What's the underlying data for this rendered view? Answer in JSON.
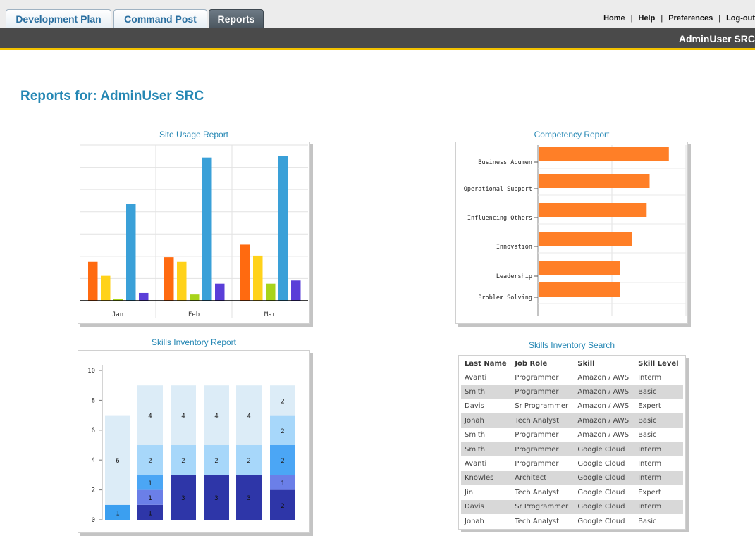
{
  "nav": {
    "tabs": [
      {
        "label": "Development Plan"
      },
      {
        "label": "Command Post"
      },
      {
        "label": "Reports"
      }
    ],
    "links": [
      "Home",
      "Help",
      "Preferences",
      "Log-out"
    ],
    "separator": "|",
    "user": "AdminUser SRC"
  },
  "page": {
    "title": "Reports for: AdminUser SRC"
  },
  "panels": {
    "site_usage": "Site Usage Report",
    "competency": "Competency Report",
    "skills_inventory": "Skills Inventory Report",
    "skills_search": "Skills Inventory Search"
  },
  "colors": {
    "accent": "#2587b4",
    "bar_orange": "#ff7f27",
    "site_series": [
      "#ff6a10",
      "#ffd21a",
      "#a8d41a",
      "#3aa0d8",
      "#5a3ed8"
    ],
    "stack_colors": [
      "#3b9ff0",
      "#2e36a8",
      "#6b7fe8",
      "#4ba6f5",
      "#a7d7fa",
      "#dcecf7"
    ]
  },
  "chart_data": [
    {
      "type": "bar",
      "title": "Site Usage Report",
      "categories": [
        "Jan",
        "Feb",
        "Mar"
      ],
      "ylim": [
        0,
        100
      ],
      "grid": true,
      "series": [
        {
          "values": [
            25,
            28,
            36
          ]
        },
        {
          "values": [
            16,
            25,
            29
          ]
        },
        {
          "values": [
            1,
            4,
            11
          ]
        },
        {
          "values": [
            62,
            92,
            93
          ]
        },
        {
          "values": [
            5,
            11,
            13
          ]
        }
      ]
    },
    {
      "type": "bar",
      "orientation": "horizontal",
      "title": "Competency Report",
      "categories": [
        "Business Acumen",
        "Operational Support",
        "Influencing Others",
        "Innovation",
        "Leadership",
        "Problem Solving"
      ],
      "values": [
        88,
        75,
        73,
        63,
        55,
        55
      ],
      "xlim": [
        0,
        100
      ],
      "grid": true
    },
    {
      "type": "bar",
      "stacked": true,
      "title": "Skills Inventory Report",
      "yticks": [
        "0",
        "2",
        "4",
        "6",
        "8",
        "10"
      ],
      "ylim": [
        0,
        10
      ],
      "columns": [
        [
          {
            "value": 1,
            "label": "1",
            "color": 0
          },
          {
            "value": 6,
            "label": "6",
            "color": 5
          }
        ],
        [
          {
            "value": 1,
            "label": "1",
            "color": 1
          },
          {
            "value": 1,
            "label": "1",
            "color": 2
          },
          {
            "value": 1,
            "label": "1",
            "color": 3
          },
          {
            "value": 2,
            "label": "2",
            "color": 4
          },
          {
            "value": 4,
            "label": "4",
            "color": 5
          }
        ],
        [
          {
            "value": 3,
            "label": "3",
            "color": 1
          },
          {
            "value": 2,
            "label": "2",
            "color": 4
          },
          {
            "value": 4,
            "label": "4",
            "color": 5
          }
        ],
        [
          {
            "value": 3,
            "label": "3",
            "color": 1
          },
          {
            "value": 2,
            "label": "2",
            "color": 4
          },
          {
            "value": 4,
            "label": "4",
            "color": 5
          }
        ],
        [
          {
            "value": 3,
            "label": "3",
            "color": 1
          },
          {
            "value": 2,
            "label": "2",
            "color": 4
          },
          {
            "value": 4,
            "label": "4",
            "color": 5
          }
        ],
        [
          {
            "value": 2,
            "label": "2",
            "color": 1
          },
          {
            "value": 1,
            "label": "1",
            "color": 2
          },
          {
            "value": 2,
            "label": "2",
            "color": 3
          },
          {
            "value": 2,
            "label": "2",
            "color": 4
          },
          {
            "value": 2,
            "label": "2",
            "color": 5
          }
        ]
      ]
    },
    {
      "type": "table",
      "title": "Skills Inventory Search",
      "columns": [
        "Last Name",
        "Job Role",
        "Skill",
        "Skill Level"
      ],
      "rows": [
        [
          "Avanti",
          "Programmer",
          "Amazon / AWS",
          "Interm"
        ],
        [
          "Smith",
          "Programmer",
          "Amazon / AWS",
          "Basic"
        ],
        [
          "Davis",
          "Sr Programmer",
          "Amazon / AWS",
          "Expert"
        ],
        [
          "Jonah",
          "Tech Analyst",
          "Amazon / AWS",
          "Basic"
        ],
        [
          "Smith",
          "Programmer",
          "Amazon / AWS",
          "Basic"
        ],
        [
          "Smith",
          "Programmer",
          "Google Cloud",
          "Interm"
        ],
        [
          "Avanti",
          "Programmer",
          "Google Cloud",
          "Interm"
        ],
        [
          "Knowles",
          "Architect",
          "Google Cloud",
          "Interm"
        ],
        [
          "Jin",
          "Tech Analyst",
          "Google Cloud",
          "Expert"
        ],
        [
          "Davis",
          "Sr Programmer",
          "Google Cloud",
          "Interm"
        ],
        [
          "Jonah",
          "Tech Analyst",
          "Google Cloud",
          "Basic"
        ]
      ]
    }
  ]
}
